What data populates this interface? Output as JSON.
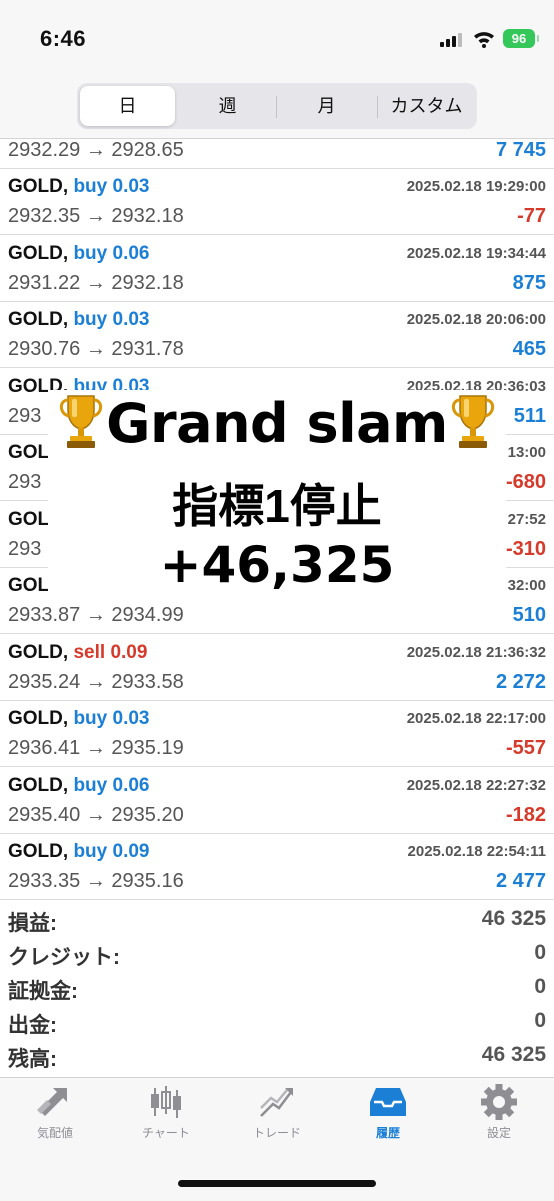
{
  "status_bar": {
    "time": "6:46",
    "battery": "96"
  },
  "tabs": [
    {
      "label": "日",
      "active": true
    },
    {
      "label": "週",
      "active": false
    },
    {
      "label": "月",
      "active": false
    },
    {
      "label": "カスタム",
      "active": false
    }
  ],
  "deals": [
    {
      "symbol": "",
      "side": "",
      "volume": "",
      "datetime": "",
      "prices": "2932.29 → 2928.65",
      "profit": "7 745",
      "sign": "pos"
    },
    {
      "symbol": "GOLD,",
      "side": "buy",
      "volume": "0.03",
      "datetime": "2025.02.18 19:29:00",
      "prices": "2932.35 → 2932.18",
      "profit": "-77",
      "sign": "neg"
    },
    {
      "symbol": "GOLD,",
      "side": "buy",
      "volume": "0.06",
      "datetime": "2025.02.18 19:34:44",
      "prices": "2931.22 → 2932.18",
      "profit": "875",
      "sign": "pos"
    },
    {
      "symbol": "GOLD,",
      "side": "buy",
      "volume": "0.03",
      "datetime": "2025.02.18 20:06:00",
      "prices": "2930.76 → 2931.78",
      "profit": "465",
      "sign": "pos"
    },
    {
      "symbol": "GOLD,",
      "side": "buy",
      "volume": "0.03",
      "datetime": "2025.02.18 20:36:03",
      "prices": "293",
      "profit": "511",
      "sign": "pos"
    },
    {
      "symbol": "GOLI",
      "side": "",
      "volume": "",
      "datetime": "13:00",
      "prices": "293",
      "profit": "-680",
      "sign": "neg"
    },
    {
      "symbol": "GOLI",
      "side": "",
      "volume": "",
      "datetime": "27:52",
      "prices": "293",
      "profit": "-310",
      "sign": "neg"
    },
    {
      "symbol": "GOLI",
      "side": "",
      "volume": "",
      "datetime": "32:00",
      "prices": "2933.87 → 2934.99",
      "profit": "510",
      "sign": "pos"
    },
    {
      "symbol": "GOLD,",
      "side": "sell",
      "volume": "0.09",
      "datetime": "2025.02.18 21:36:32",
      "prices": "2935.24 → 2933.58",
      "profit": "2 272",
      "sign": "pos"
    },
    {
      "symbol": "GOLD,",
      "side": "buy",
      "volume": "0.03",
      "datetime": "2025.02.18 22:17:00",
      "prices": "2936.41 → 2935.19",
      "profit": "-557",
      "sign": "neg"
    },
    {
      "symbol": "GOLD,",
      "side": "buy",
      "volume": "0.06",
      "datetime": "2025.02.18 22:27:32",
      "prices": "2935.40 → 2935.20",
      "profit": "-182",
      "sign": "neg"
    },
    {
      "symbol": "GOLD,",
      "side": "buy",
      "volume": "0.09",
      "datetime": "2025.02.18 22:54:11",
      "prices": "2933.35 → 2935.16",
      "profit": "2 477",
      "sign": "pos"
    }
  ],
  "overlay": {
    "line1": "Grand slam",
    "line2": "指標1停止",
    "line3": "+46,325"
  },
  "summary": [
    {
      "label": "損益:",
      "value": "46 325"
    },
    {
      "label": "クレジット:",
      "value": "0"
    },
    {
      "label": "証拠金:",
      "value": "0"
    },
    {
      "label": "出金:",
      "value": "0"
    },
    {
      "label": "残高:",
      "value": "46 325"
    }
  ],
  "tabbar": [
    {
      "label": "気配値",
      "icon": "quotes-icon",
      "active": false
    },
    {
      "label": "チャート",
      "icon": "chart-icon",
      "active": false
    },
    {
      "label": "トレード",
      "icon": "trade-icon",
      "active": false
    },
    {
      "label": "履歴",
      "icon": "history-icon",
      "active": true
    },
    {
      "label": "設定",
      "icon": "settings-icon",
      "active": false
    }
  ],
  "colors": {
    "buy": "#1b7fd6",
    "sell": "#d63a2a",
    "accent": "#1b7fd6"
  }
}
